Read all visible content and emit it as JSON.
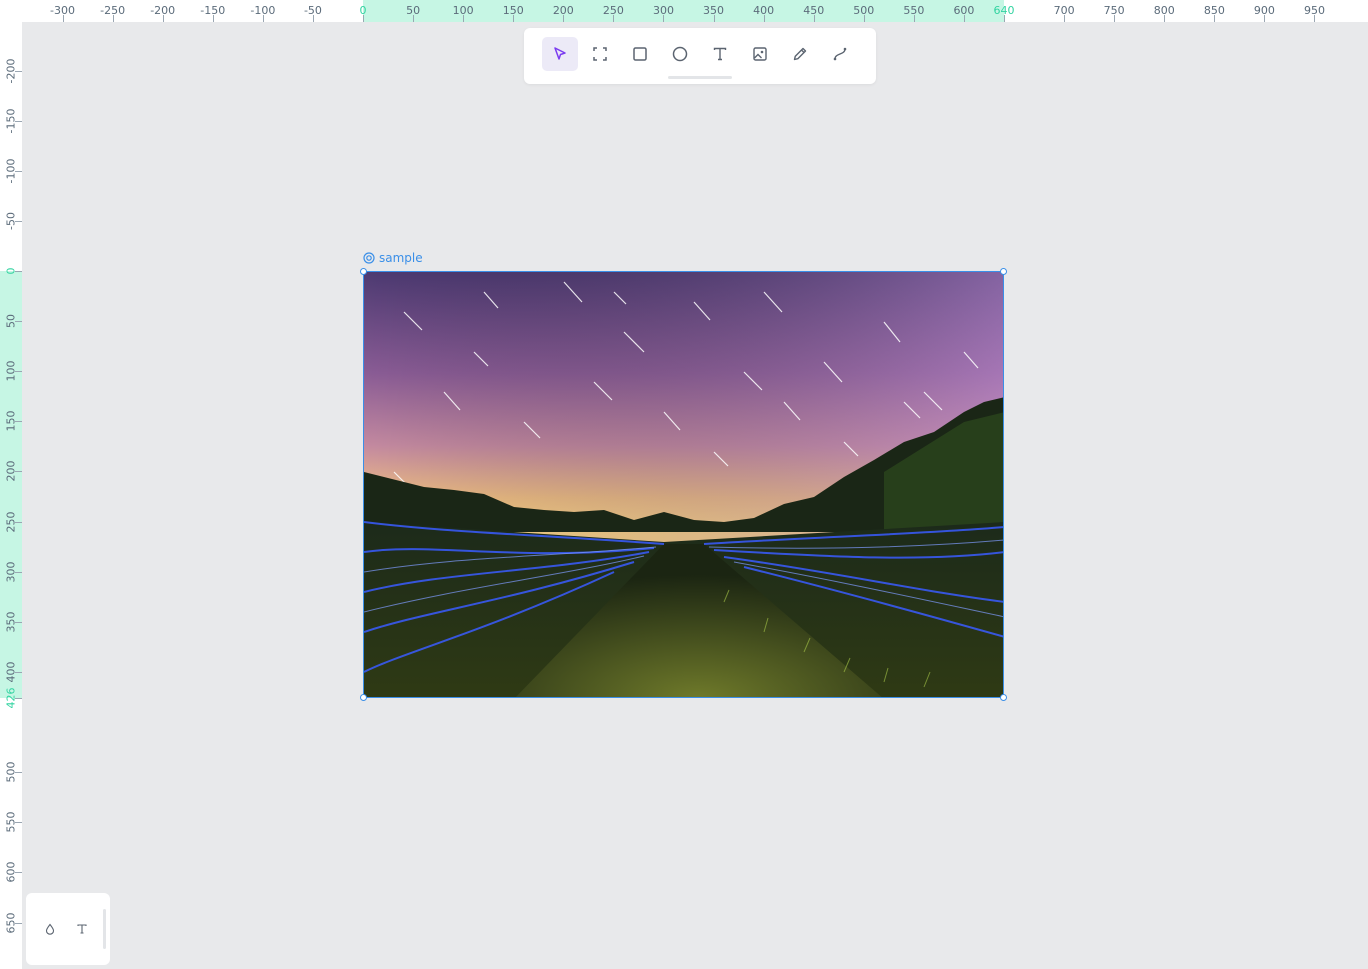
{
  "ruler": {
    "top_labels": [
      "-300",
      "-250",
      "-200",
      "-150",
      "-100",
      "-50",
      "0",
      "50",
      "100",
      "150",
      "200",
      "250",
      "300",
      "350",
      "400",
      "450",
      "500",
      "550",
      "600",
      "640",
      "700",
      "750",
      "800",
      "850",
      "900",
      "950"
    ],
    "left_labels": [
      "-200",
      "-150",
      "-100",
      "-50",
      "0",
      "50",
      "100",
      "150",
      "200",
      "250",
      "300",
      "350",
      "400",
      "426",
      "500",
      "550",
      "600",
      "650"
    ],
    "accent_color": "#31d3a0"
  },
  "toolbar": {
    "tools": [
      {
        "name": "select",
        "icon": "cursor-arrow-icon",
        "active": true
      },
      {
        "name": "board",
        "icon": "frame-icon",
        "active": false
      },
      {
        "name": "rectangle",
        "icon": "square-icon",
        "active": false
      },
      {
        "name": "ellipse",
        "icon": "circle-icon",
        "active": false
      },
      {
        "name": "text",
        "icon": "text-t-icon",
        "active": false
      },
      {
        "name": "image",
        "icon": "image-icon",
        "active": false
      },
      {
        "name": "pencil",
        "icon": "pencil-icon",
        "active": false
      },
      {
        "name": "path",
        "icon": "curve-path-icon",
        "active": false
      }
    ],
    "active_color": "#7b3cf0"
  },
  "board": {
    "name": "sample",
    "image_description_icon": "photo-night-field",
    "selection_color": "#3a8fe8"
  },
  "bottom_panel": {
    "tools": [
      {
        "name": "color-drop",
        "icon": "drop-icon"
      },
      {
        "name": "typography",
        "icon": "text-t-icon"
      }
    ]
  }
}
